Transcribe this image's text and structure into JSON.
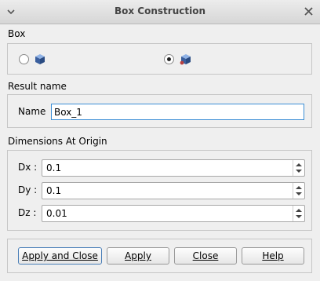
{
  "window": {
    "title": "Box Construction",
    "menu_icon": "chevron-down-icon",
    "close_icon": "close-icon"
  },
  "box_type": {
    "label": "Box",
    "options": [
      {
        "icon": "cube-icon",
        "selected": false
      },
      {
        "icon": "cube-origin-icon",
        "selected": true
      }
    ]
  },
  "result": {
    "section_label": "Result name",
    "name_label": "Name",
    "name_value": "Box_1"
  },
  "dimensions": {
    "section_label": "Dimensions At Origin",
    "dx_label": "Dx :",
    "dx_value": "0.1",
    "dy_label": "Dy :",
    "dy_value": "0.1",
    "dz_label": "Dz :",
    "dz_value": "0.01"
  },
  "buttons": {
    "apply_close": "Apply and Close",
    "apply": "Apply",
    "close": "Close",
    "help": "Help"
  },
  "colors": {
    "focus_border": "#3c8fd6",
    "cube_blue": "#3a5f9e",
    "cube_red": "#b84040"
  }
}
